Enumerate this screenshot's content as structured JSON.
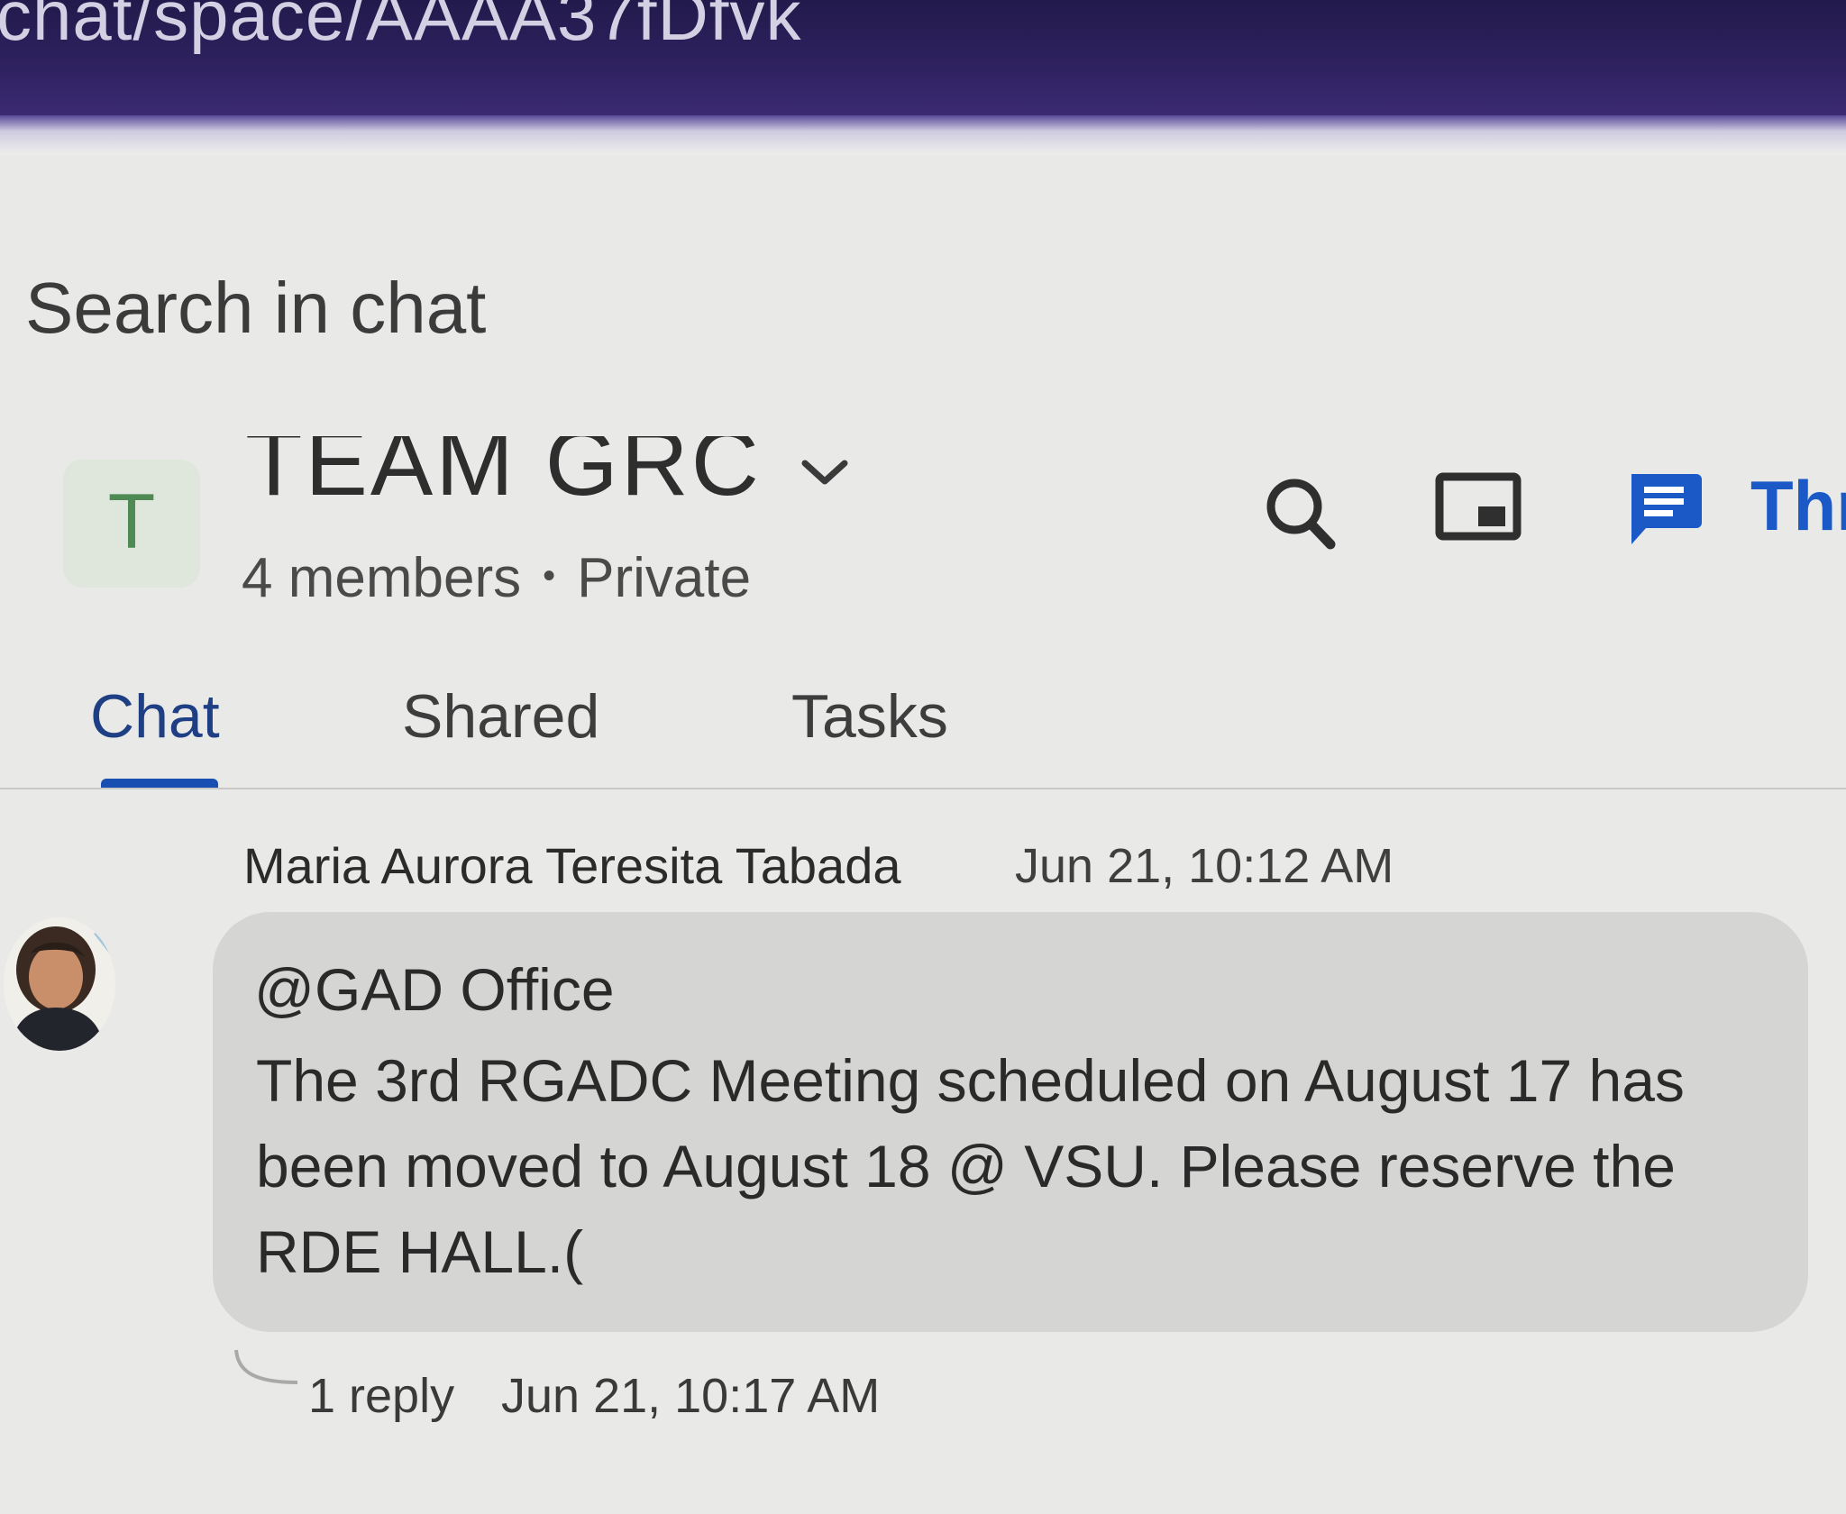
{
  "browser": {
    "url_fragment": "chat/space/AAAA37fDfvk"
  },
  "search": {
    "placeholder": "Search in chat"
  },
  "space": {
    "avatar_letter": "T",
    "name": "TEAM GRC",
    "members": "4 members",
    "visibility": "Private"
  },
  "header_actions": {
    "search_icon": "search-icon",
    "panel_icon": "picture-in-picture-icon",
    "threads_icon": "threads-icon",
    "threads_label": "Thr"
  },
  "tabs": [
    {
      "label": "Chat",
      "active": true
    },
    {
      "label": "Shared",
      "active": false
    },
    {
      "label": "Tasks",
      "active": false
    }
  ],
  "message": {
    "sender": "Maria Aurora Teresita Tabada",
    "timestamp": "Jun 21, 10:12 AM",
    "mention": "@GAD Office",
    "body": "The 3rd RGADC Meeting scheduled on August 17 has been moved to August 18 @ VSU. Please reserve the RDE HALL.(",
    "reply_count": "1 reply",
    "reply_timestamp": "Jun 21, 10:17 AM"
  },
  "colors": {
    "accent_blue": "#1a4fb2",
    "threads_blue": "#1b59c7",
    "avatar_green": "#4f8a55",
    "bubble_gray": "#d5d6d3",
    "urlbar_purple": "#2f2260"
  }
}
